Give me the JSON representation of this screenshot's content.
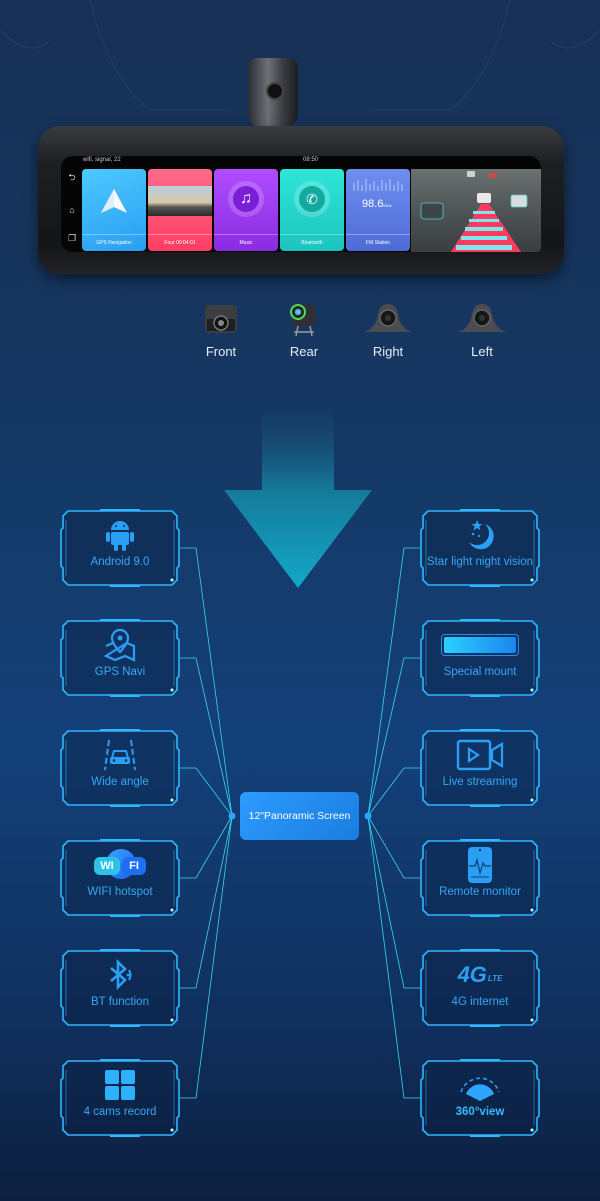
{
  "device": {
    "status_bar": {
      "icons": "wifi, signal, 22",
      "time": "08:50"
    },
    "side_nav": [
      {
        "icon": "back-icon",
        "glyph": "⮌"
      },
      {
        "icon": "home-icon",
        "glyph": "⌂"
      },
      {
        "icon": "recent-apps-icon",
        "glyph": "❐"
      }
    ],
    "apps": [
      {
        "label": "GPS Navigation",
        "icon": "navigation-arrow-icon"
      },
      {
        "label": "Four 00:04:01",
        "icon": "road-video-icon"
      },
      {
        "label": "Music",
        "icon": "music-note-icon"
      },
      {
        "label": "Bluetooth",
        "icon": "phone-icon"
      },
      {
        "label": "FM Station",
        "icon": "radio-wave-icon",
        "frequency": "98.6",
        "unit": "MHz"
      }
    ],
    "road_view": "lane-assist-camera-view"
  },
  "cameras": [
    {
      "label": "Front",
      "icon": "front-camera-icon"
    },
    {
      "label": "Rear",
      "icon": "rear-camera-icon"
    },
    {
      "label": "Right",
      "icon": "side-camera-icon"
    },
    {
      "label": "Left",
      "icon": "side-camera-icon"
    }
  ],
  "center": {
    "label": "12\"Panoramic Screen"
  },
  "features_left": [
    {
      "label": "Android 9.0",
      "icon": "android-icon"
    },
    {
      "label": "GPS Navi",
      "icon": "map-pin-icon"
    },
    {
      "label": "Wide angle",
      "icon": "car-lane-icon"
    },
    {
      "label": "WIFI hotspot",
      "icon": "wifi-icon",
      "badge_a": "WI",
      "badge_b": "FI"
    },
    {
      "label": "BT function",
      "icon": "bluetooth-icon"
    },
    {
      "label": "4 cams record",
      "icon": "four-grid-icon"
    }
  ],
  "features_right": [
    {
      "label": "Star light night vision",
      "icon": "moon-star-icon"
    },
    {
      "label": "Special mount",
      "icon": "mount-bar-icon"
    },
    {
      "label": "Live streaming",
      "icon": "video-camera-icon"
    },
    {
      "label": "Remote monitor",
      "icon": "phone-monitor-icon"
    },
    {
      "label": "4G internet",
      "icon": "4g-lte-icon",
      "badge": "4G",
      "badge_sub": "LTE"
    },
    {
      "label": "360°view",
      "icon": "360-view-icon"
    }
  ],
  "colors": {
    "accent": "#35a8f5",
    "frame": "#2fb6ff",
    "line": "#38d4f0",
    "center_box": "#1f8cf0",
    "arrow": "#14a6c6"
  }
}
